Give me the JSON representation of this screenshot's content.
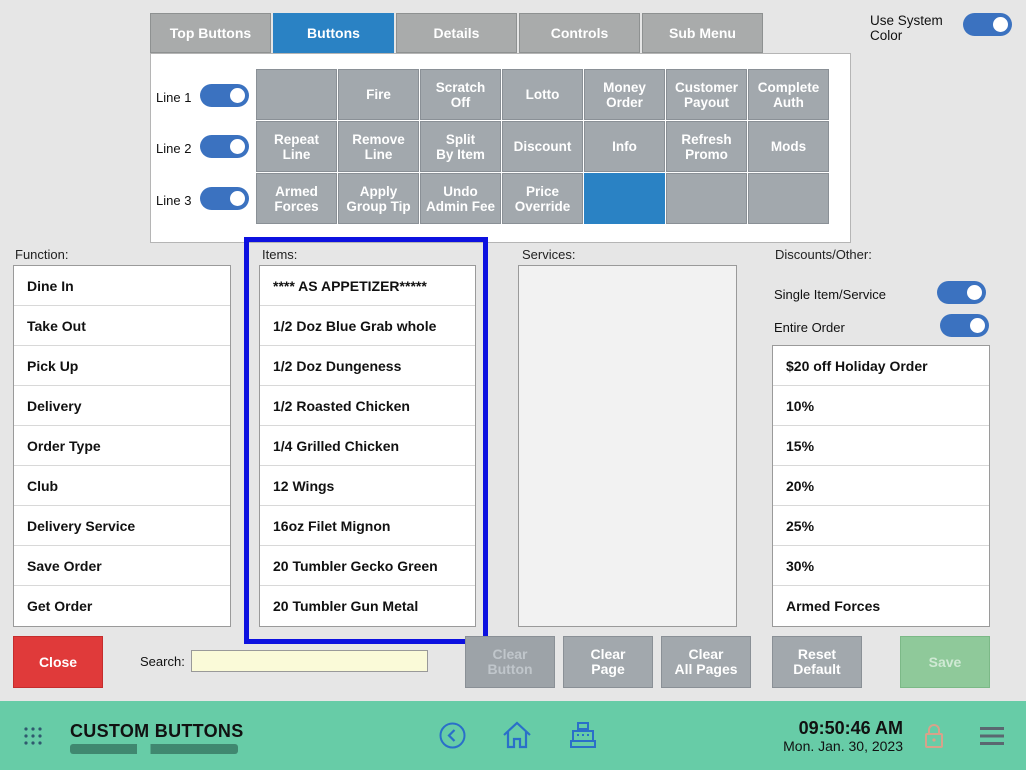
{
  "tabs": [
    {
      "label": "Top Buttons",
      "active": false
    },
    {
      "label": "Buttons",
      "active": true
    },
    {
      "label": "Details",
      "active": false
    },
    {
      "label": "Controls",
      "active": false
    },
    {
      "label": "Sub Menu",
      "active": false
    }
  ],
  "system_color": {
    "label": "Use System Color",
    "on": true
  },
  "lines": [
    {
      "label": "Line 1",
      "on": true
    },
    {
      "label": "Line 2",
      "on": true
    },
    {
      "label": "Line 3",
      "on": true
    }
  ],
  "button_grid": [
    [
      "",
      "Fire",
      "Scratch\nOff",
      "Lotto",
      "Money\nOrder",
      "Customer\nPayout",
      "Complete\nAuth"
    ],
    [
      "Repeat\nLine",
      "Remove\nLine",
      "Split\nBy Item",
      "Discount",
      "Info",
      "Refresh\nPromo",
      "Mods"
    ],
    [
      "Armed\nForces",
      "Apply\nGroup Tip",
      "Undo\nAdmin Fee",
      "Price\nOverride",
      "",
      "",
      ""
    ]
  ],
  "selected_grid_cell": {
    "row": 2,
    "col": 4
  },
  "function": {
    "label": "Function:",
    "items": [
      "Dine In",
      "Take Out",
      "Pick Up",
      "Delivery",
      "Order Type",
      "Club",
      "Delivery Service",
      "Save Order",
      "Get Order"
    ]
  },
  "items": {
    "label": "Items:",
    "items": [
      "**** AS APPETIZER*****",
      "1/2 Doz Blue Grab whole",
      "1/2 Doz Dungeness",
      "1/2 Roasted Chicken",
      "1/4 Grilled Chicken",
      "12 Wings",
      "16oz Filet Mignon",
      "20 Tumbler Gecko Green",
      "20 Tumbler Gun Metal"
    ]
  },
  "services": {
    "label": "Services:"
  },
  "discounts": {
    "label": "Discounts/Other:",
    "single_toggle": {
      "label": "Single Item/Service",
      "on": true
    },
    "entire_toggle": {
      "label": "Entire Order",
      "on": true
    },
    "items": [
      "$20 off Holiday Order",
      "10%",
      "15%",
      "20%",
      "25%",
      "30%",
      "Armed Forces"
    ]
  },
  "bottom": {
    "close": "Close",
    "search_label": "Search:",
    "search_value": "",
    "clear_button": "Clear\nButton",
    "clear_page": "Clear\nPage",
    "clear_all": "Clear\nAll Pages",
    "reset_default": "Reset\nDefault",
    "save": "Save"
  },
  "footer": {
    "title": "CUSTOM BUTTONS",
    "time": "09:50:46 AM",
    "date": "Mon. Jan. 30, 2023"
  },
  "colors": {
    "accent": "#2a82c4",
    "footer": "#67cca7",
    "close": "#e03a3a",
    "highlight": "#0d11e0"
  },
  "icons": [
    "apps-grid-icon",
    "back-icon",
    "home-icon",
    "register-icon",
    "lock-icon",
    "menu-icon"
  ]
}
